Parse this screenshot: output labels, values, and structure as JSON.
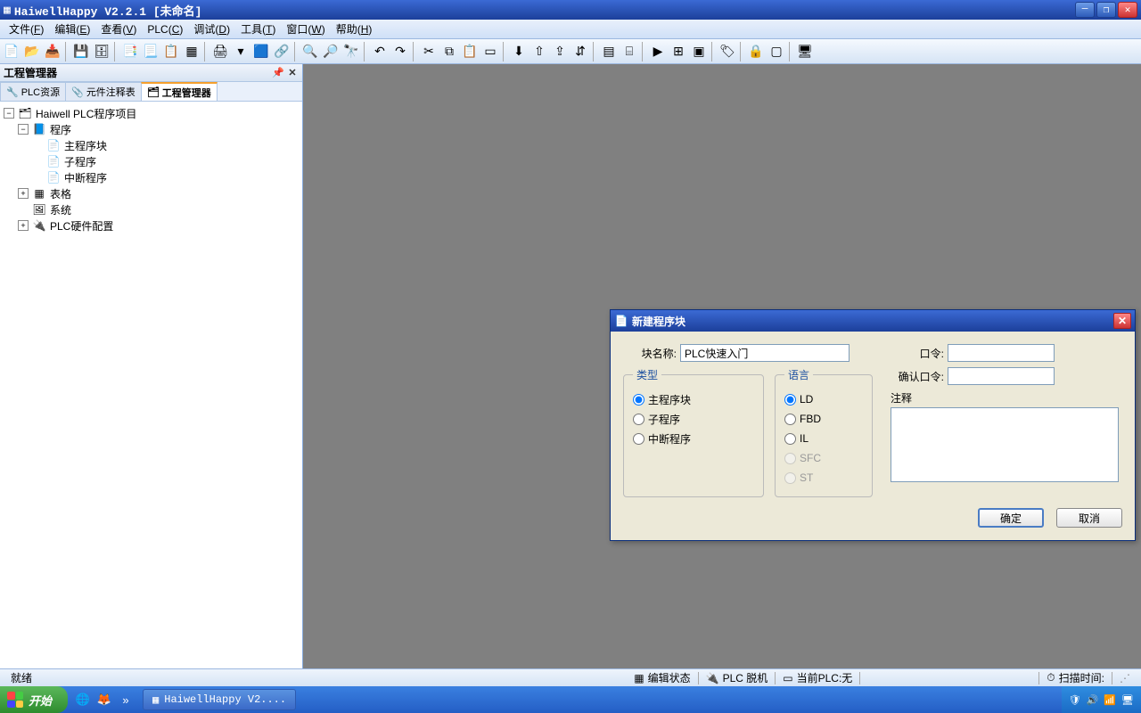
{
  "titlebar": {
    "text": "HaiwellHappy V2.2.1 [未命名]"
  },
  "menus": [
    {
      "label": "文件",
      "key": "F"
    },
    {
      "label": "编辑",
      "key": "E"
    },
    {
      "label": "查看",
      "key": "V"
    },
    {
      "label": "PLC",
      "key": "C"
    },
    {
      "label": "调试",
      "key": "D"
    },
    {
      "label": "工具",
      "key": "T"
    },
    {
      "label": "窗口",
      "key": "W"
    },
    {
      "label": "帮助",
      "key": "H"
    }
  ],
  "panel": {
    "title": "工程管理器",
    "tabs": [
      {
        "label": "PLC资源",
        "icon": "🔧"
      },
      {
        "label": "元件注释表",
        "icon": "📎"
      },
      {
        "label": "工程管理器",
        "icon": "🗂"
      }
    ],
    "tree": {
      "root": "Haiwell PLC程序项目",
      "program": "程序",
      "main_block": "主程序块",
      "sub_prog": "子程序",
      "int_prog": "中断程序",
      "table": "表格",
      "system": "系统",
      "hw_config": "PLC硬件配置"
    }
  },
  "dialog": {
    "title": "新建程序块",
    "block_name_label": "块名称:",
    "block_name_value": "PLC快速入门",
    "password_label": "口令:",
    "confirm_pwd_label": "确认口令:",
    "type_legend": "类型",
    "type_options": [
      "主程序块",
      "子程序",
      "中断程序"
    ],
    "lang_legend": "语言",
    "lang_options": [
      {
        "label": "LD",
        "enabled": true
      },
      {
        "label": "FBD",
        "enabled": true
      },
      {
        "label": "IL",
        "enabled": true
      },
      {
        "label": "SFC",
        "enabled": false
      },
      {
        "label": "ST",
        "enabled": false
      }
    ],
    "comment_label": "注释",
    "ok": "确定",
    "cancel": "取消"
  },
  "status": {
    "ready": "就绪",
    "edit_state": "编辑状态",
    "plc_off": "PLC 脱机",
    "current_plc": "当前PLC:无",
    "scan": "扫描时间:"
  },
  "taskbar": {
    "start": "开始",
    "task": "HaiwellHappy V2...."
  }
}
